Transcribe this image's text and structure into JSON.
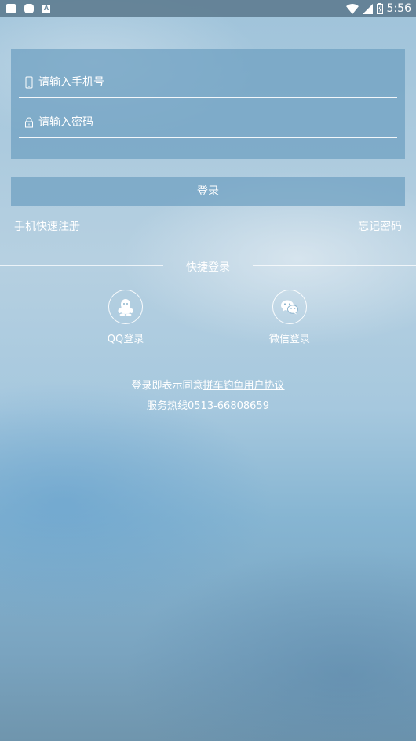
{
  "status_bar": {
    "time": "5:56",
    "notification_badge": "A"
  },
  "form": {
    "phone_placeholder": "请输入手机号",
    "password_placeholder": "请输入密码"
  },
  "login_button": "登录",
  "links": {
    "register": "手机快速注册",
    "forgot": "忘记密码"
  },
  "quick_login": {
    "title": "快捷登录",
    "qq_label": "QQ登录",
    "wechat_label": "微信登录"
  },
  "agreement": {
    "prefix": "登录即表示同意",
    "link": "拼车钓鱼用户协议"
  },
  "hotline": "服务热线0513-66808659"
}
